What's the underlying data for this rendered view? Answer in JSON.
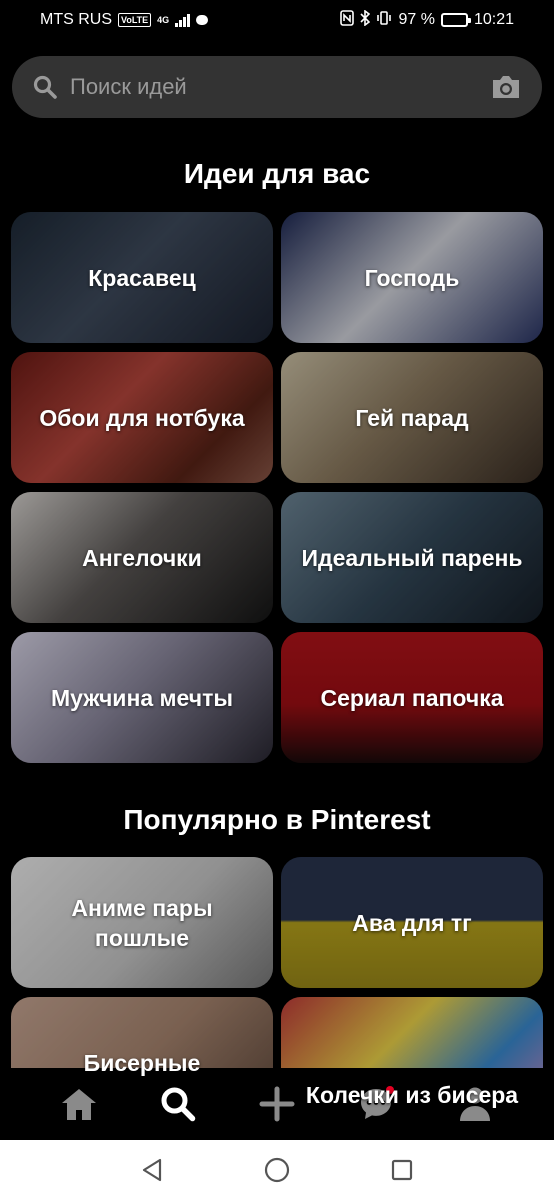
{
  "status_bar": {
    "carrier": "MTS RUS",
    "volte": "VoLTE",
    "network": "4G",
    "battery_percent": "97 %",
    "battery_level": 0.97,
    "time": "10:21"
  },
  "search": {
    "placeholder": "Поиск идей"
  },
  "sections": [
    {
      "title": "Идеи для вас",
      "tiles": [
        {
          "label": "Красавец"
        },
        {
          "label": "Господь"
        },
        {
          "label": "Обои для нотбука"
        },
        {
          "label": "Гей парад"
        },
        {
          "label": "Ангелочки"
        },
        {
          "label": "Идеальный парень"
        },
        {
          "label": "Мужчина мечты"
        },
        {
          "label": "Сериал папочка"
        }
      ]
    },
    {
      "title": "Популярно в Pinterest",
      "tiles": [
        {
          "label": "Аниме пары пошлые"
        },
        {
          "label": "Ава для тг"
        },
        {
          "label": "Бисерные"
        },
        {
          "label": "Колечки из бисера"
        }
      ]
    }
  ],
  "bottom_nav": {
    "items": [
      {
        "icon": "home-icon"
      },
      {
        "icon": "search-icon",
        "active": true
      },
      {
        "icon": "plus-icon"
      },
      {
        "icon": "messages-icon",
        "has_notification": true
      },
      {
        "icon": "profile-icon"
      }
    ]
  },
  "colors": {
    "background": "#000000",
    "search_bg": "#333333",
    "notification": "#e60023",
    "icon_inactive": "#8a8a8a",
    "icon_active": "#ffffff"
  }
}
